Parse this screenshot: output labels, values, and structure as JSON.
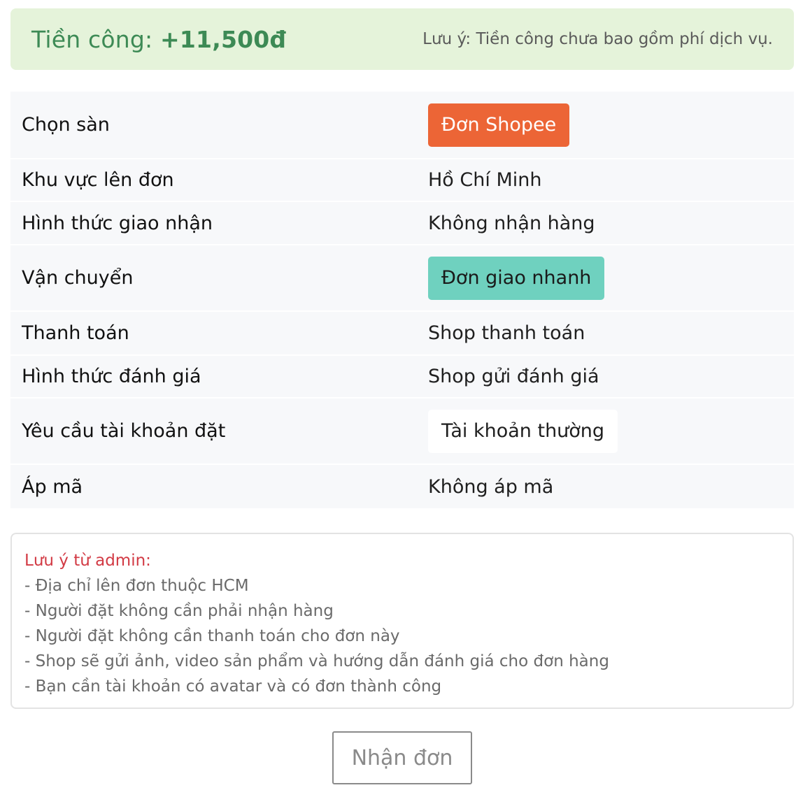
{
  "earning": {
    "label": "Tiền công: ",
    "amount": "+11,500đ",
    "note": "Lưu ý: Tiền công chưa bao gồm phí dịch vụ."
  },
  "details": [
    {
      "label": "Chọn sàn",
      "value": "Đơn Shopee"
    },
    {
      "label": "Khu vực lên đơn",
      "value": "Hồ Chí Minh"
    },
    {
      "label": "Hình thức giao nhận",
      "value": "Không nhận hàng"
    },
    {
      "label": "Vận chuyển",
      "value": "Đơn giao nhanh"
    },
    {
      "label": "Thanh toán",
      "value": "Shop thanh toán"
    },
    {
      "label": "Hình thức đánh giá",
      "value": "Shop gửi đánh giá"
    },
    {
      "label": "Yêu cầu tài khoản đặt",
      "value": "Tài khoản thường"
    },
    {
      "label": "Áp mã",
      "value": "Không áp mã"
    }
  ],
  "admin_note": {
    "title": "Lưu ý từ admin:",
    "lines": [
      "- Địa chỉ lên đơn thuộc HCM",
      "- Người đặt không cần phải nhận hàng",
      "- Người đặt không cần thanh toán cho đơn này",
      "- Shop sẽ gửi ảnh, video sản phẩm và hướng dẫn đánh giá cho đơn hàng",
      "- Bạn cần tài khoản có avatar và có đơn thành công"
    ]
  },
  "accept_button": "Nhận đơn",
  "colors": {
    "earning_bg": "#e5f3da",
    "earning_text": "#3d8a55",
    "shopee_chip": "#ec6536",
    "fast_chip": "#6fd1bf",
    "admin_title": "#d23a44"
  }
}
